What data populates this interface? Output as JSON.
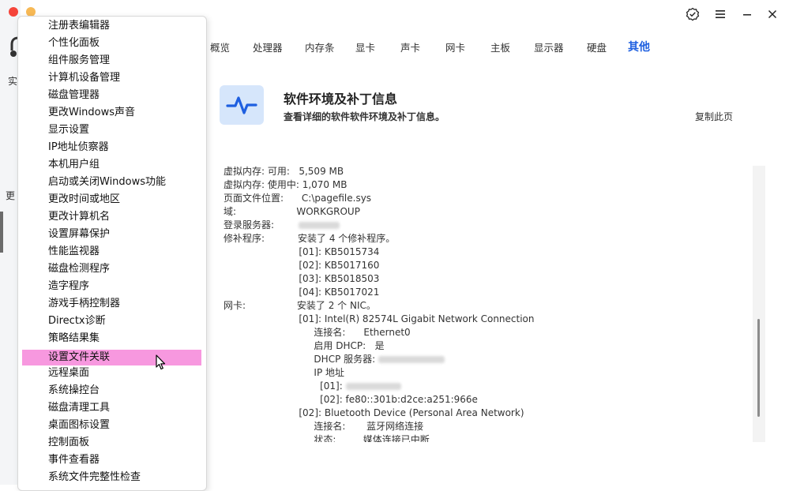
{
  "left_strip": {
    "partial_labels": [
      "实",
      "更"
    ]
  },
  "tabs": [
    {
      "label": "概览"
    },
    {
      "label": "处理器"
    },
    {
      "label": "内存条"
    },
    {
      "label": "显卡"
    },
    {
      "label": "声卡"
    },
    {
      "label": "网卡"
    },
    {
      "label": "主板"
    },
    {
      "label": "显示器"
    },
    {
      "label": "硬盘"
    },
    {
      "label": "其他",
      "active": true
    }
  ],
  "header": {
    "title": "软件环境及补丁信息",
    "subtitle": "查看详细的软件软件环境及补丁信息。",
    "copy_label": "复制此页",
    "icon": "pulse-icon"
  },
  "info_lines": [
    {
      "text": "虚拟内存: 可用:   5,509 MB"
    },
    {
      "text": "虚拟内存: 使用中: 1,070 MB"
    },
    {
      "text": "页面文件位置:      C:\\pagefile.sys"
    },
    {
      "text": "域:                    WORKGROUP"
    },
    {
      "text": "登录服务器:        ",
      "redacted": true
    },
    {
      "text": "修补程序:           安装了 4 个修补程序。"
    },
    {
      "text": "                         [01]: KB5015734"
    },
    {
      "text": "                         [02]: KB5017160"
    },
    {
      "text": "                         [03]: KB5018503"
    },
    {
      "text": "                         [04]: KB5017021"
    },
    {
      "text": "网卡:                 安装了 2 个 NIC。"
    },
    {
      "text": "                         [01]: Intel(R) 82574L Gigabit Network Connection"
    },
    {
      "text": "                              连接名:      Ethernet0"
    },
    {
      "text": "                              启用 DHCP:   是"
    },
    {
      "text": "                              DHCP 服务器: ",
      "redacted": true
    },
    {
      "text": "                              IP 地址"
    },
    {
      "text": "                                [01]: ",
      "redacted": true
    },
    {
      "text": "                                [02]: fe80::301b:d2ce:a251:966e"
    },
    {
      "text": "                         [02]: Bluetooth Device (Personal Area Network)"
    },
    {
      "text": "                              连接名:       蓝牙网络连接"
    },
    {
      "text": "                              状态:         媒体连接已中断"
    }
  ],
  "context_menu": [
    "注册表编辑器",
    "个性化面板",
    "组件服务管理",
    "计算机设备管理",
    "磁盘管理器",
    "更改Windows声音",
    "显示设置",
    "IP地址侦察器",
    "本机用户组",
    "启动或关闭Windows功能",
    "更改时间或地区",
    "更改计算机名",
    "设置屏幕保护",
    "性能监视器",
    "磁盘检测程序",
    "造字程序",
    "游戏手柄控制器",
    "Directx诊断",
    "策略结果集",
    "设置文件关联",
    "远程桌面",
    "系统操控台",
    "磁盘清理工具",
    "桌面图标设置",
    "控制面板",
    "事件查看器",
    "系统文件完整性检查"
  ],
  "highlighted_menu_index": 19,
  "colors": {
    "accent": "#1e5fe0",
    "highlight": "#f798df",
    "icon_bg": "#d6e6fb"
  }
}
